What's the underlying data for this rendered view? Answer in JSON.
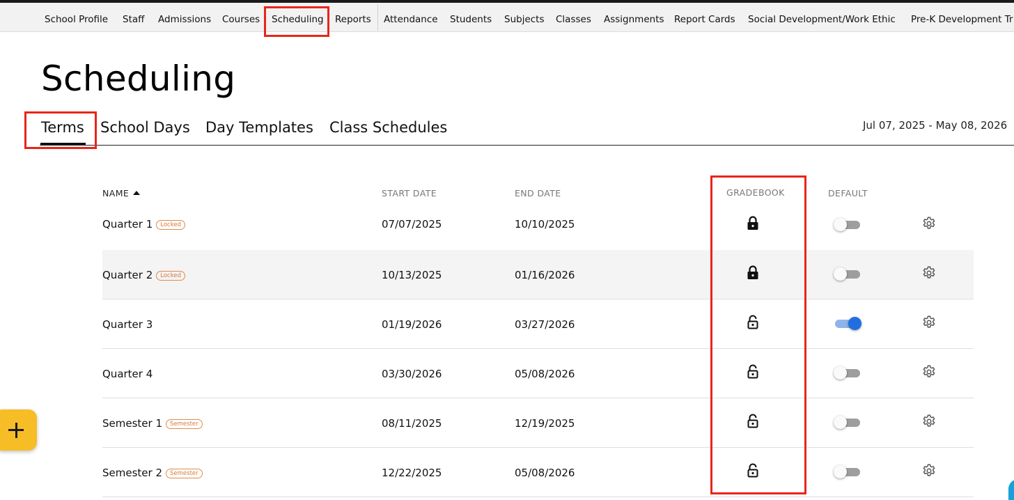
{
  "nav": {
    "items": [
      "School Profile",
      "Staff",
      "Admissions",
      "Courses",
      "Scheduling",
      "Reports",
      "Attendance",
      "Students",
      "Subjects",
      "Classes",
      "Assignments",
      "Report Cards",
      "Social Development/Work Ethic",
      "Pre-K Development Tr"
    ],
    "active": "Scheduling"
  },
  "page": {
    "title": "Scheduling"
  },
  "tabs": {
    "items": [
      "Terms",
      "School Days",
      "Day Templates",
      "Class Schedules"
    ],
    "active": "Terms"
  },
  "date_range": "Jul 07, 2025 - May 08, 2026",
  "table": {
    "headers": {
      "name": "NAME",
      "start_date": "START DATE",
      "end_date": "END DATE",
      "gradebook": "GRADEBOOK",
      "default": "DEFAULT"
    },
    "sort": {
      "column": "name",
      "direction": "ascending"
    },
    "rows": [
      {
        "name": "Quarter 1",
        "badge": "Locked",
        "start": "07/07/2025",
        "end": "10/10/2025",
        "gradebook": "locked",
        "default": false
      },
      {
        "name": "Quarter 2",
        "badge": "Locked",
        "start": "10/13/2025",
        "end": "01/16/2026",
        "gradebook": "locked",
        "default": false
      },
      {
        "name": "Quarter 3",
        "badge": "",
        "start": "01/19/2026",
        "end": "03/27/2026",
        "gradebook": "unlocked",
        "default": true
      },
      {
        "name": "Quarter 4",
        "badge": "",
        "start": "03/30/2026",
        "end": "05/08/2026",
        "gradebook": "unlocked",
        "default": false
      },
      {
        "name": "Semester 1",
        "badge": "Semester",
        "start": "08/11/2025",
        "end": "12/19/2025",
        "gradebook": "unlocked",
        "default": false
      },
      {
        "name": "Semester 2",
        "badge": "Semester",
        "start": "12/22/2025",
        "end": "05/08/2026",
        "gradebook": "unlocked",
        "default": false
      }
    ]
  },
  "icons": {
    "locked": "lock-closed-icon",
    "unlocked": "lock-open-icon",
    "settings": "gear-icon",
    "add": "plus-icon"
  },
  "colors": {
    "highlight": "#e8251b",
    "toggle_on": "#1f6fe0",
    "badge": "#d9773a",
    "fab": "#f7bd26"
  }
}
